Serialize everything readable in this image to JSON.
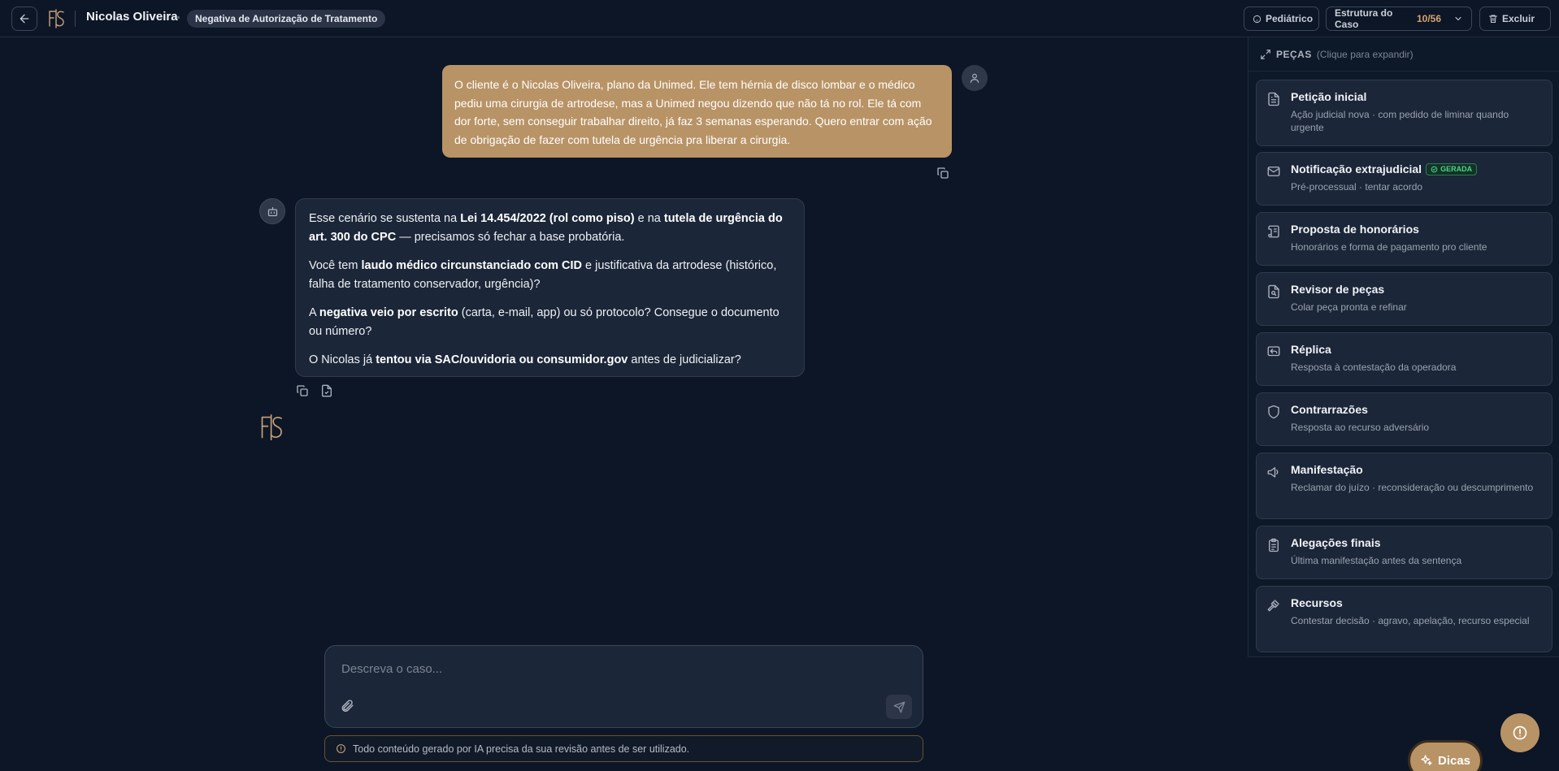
{
  "header": {
    "client_name": "Nicolas Oliveira",
    "case_type": "Negativa de Autorização de Tratamento",
    "pediatric_label": "Pediátrico",
    "structure_label": "Estrutura do Caso",
    "structure_count": "10/56",
    "delete_label": "Excluir"
  },
  "chat": {
    "user_message": "O cliente é o Nicolas Oliveira, plano da Unimed. Ele tem hérnia de disco lombar e o médico pediu uma cirurgia de artrodese, mas a Unimed negou dizendo que não tá no rol. Ele tá com dor forte, sem conseguir trabalhar direito, já faz 3 semanas esperando. Quero entrar com ação de obrigação de fazer com tutela de urgência pra liberar a cirurgia.",
    "bot_message": {
      "p1_a": "Esse cenário se sustenta na ",
      "p1_b": "Lei 14.454/2022 (rol como piso)",
      "p1_c": " e na ",
      "p1_d": "tutela de urgência do art. 300 do CPC",
      "p1_e": " — precisamos só fechar a base probatória.",
      "p2_a": "Você tem ",
      "p2_b": "laudo médico circunstanciado com CID",
      "p2_c": " e justificativa da artrodese (histórico, falha de tratamento conservador, urgência)?",
      "p3_a": "A ",
      "p3_b": "negativa veio por escrito",
      "p3_c": " (carta, e-mail, app) ou só protocolo? Consegue o documento ou número?",
      "p4_a": "O Nicolas já ",
      "p4_b": "tentou via SAC/ouvidoria ou consumidor.gov",
      "p4_c": " antes de judicializar?"
    }
  },
  "composer": {
    "placeholder": "Descreva o caso...",
    "disclaimer": "Todo conteúdo gerado por IA precisa da sua revisão antes de ser utilizado."
  },
  "panel": {
    "title": "PEÇAS",
    "hint": "(Clique para expandir)",
    "generated_label": "GERADA",
    "items": [
      {
        "title": "Petição inicial",
        "desc": "Ação judicial nova · com pedido de liminar quando urgente",
        "icon": "document-icon"
      },
      {
        "title": "Notificação extrajudicial",
        "desc": "Pré-processual · tentar acordo",
        "icon": "mail-icon",
        "generated": true
      },
      {
        "title": "Proposta de honorários",
        "desc": "Honorários e forma de pagamento pro cliente",
        "icon": "scroll-icon"
      },
      {
        "title": "Revisor de peças",
        "desc": "Colar peça pronta e refinar",
        "icon": "file-search-icon"
      },
      {
        "title": "Réplica",
        "desc": "Resposta à contestação da operadora",
        "icon": "reply-icon"
      },
      {
        "title": "Contrarrazões",
        "desc": "Resposta ao recurso adversário",
        "icon": "shield-icon"
      },
      {
        "title": "Manifestação",
        "desc": "Reclamar do juízo · reconsideração ou descumprimento",
        "icon": "megaphone-icon"
      },
      {
        "title": "Alegações finais",
        "desc": "Última manifestação antes da sentença",
        "icon": "clipboard-icon"
      },
      {
        "title": "Recursos",
        "desc": "Contestar decisão · agravo, apelação, recurso especial",
        "icon": "gavel-icon"
      }
    ]
  },
  "floating": {
    "tips_label": "Dicas"
  },
  "colors": {
    "background": "#0c1626",
    "accent": "#b89366",
    "card": "#1b2638",
    "generated": "#4fd08c"
  }
}
